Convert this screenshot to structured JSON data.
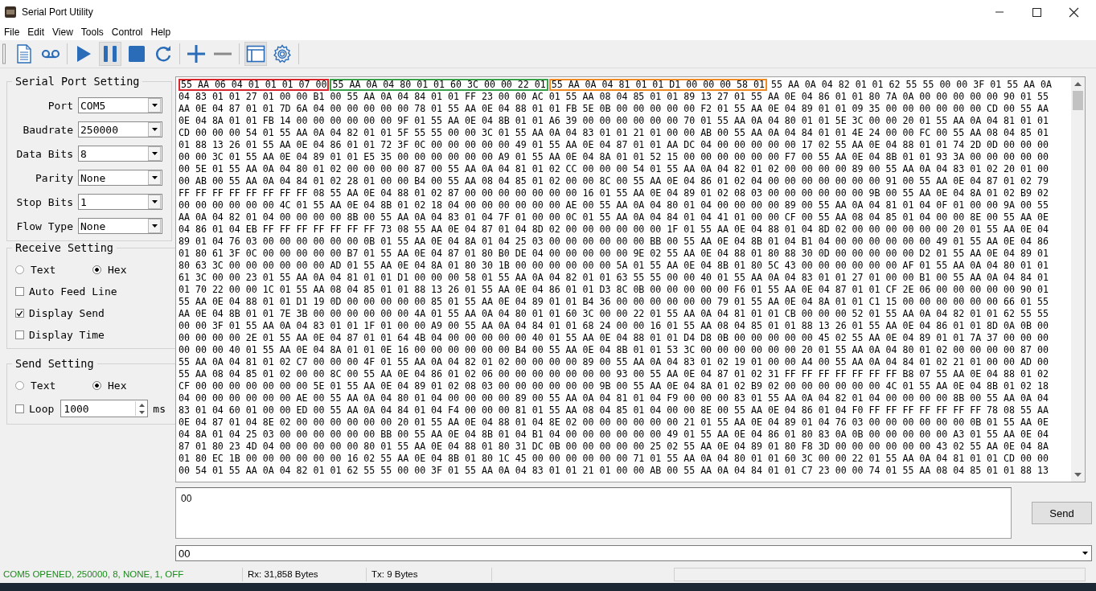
{
  "window": {
    "title": "Serial Port Utility"
  },
  "menu": [
    "File",
    "Edit",
    "View",
    "Tools",
    "Control",
    "Help"
  ],
  "toolbar": [
    {
      "kind": "document",
      "pressed": false
    },
    {
      "kind": "cassette",
      "pressed": false
    },
    {
      "kind": "separator"
    },
    {
      "kind": "play",
      "pressed": false
    },
    {
      "kind": "pause",
      "pressed": true
    },
    {
      "kind": "stop",
      "pressed": false
    },
    {
      "kind": "refresh",
      "pressed": false
    },
    {
      "kind": "separator"
    },
    {
      "kind": "plus",
      "pressed": false
    },
    {
      "kind": "minus",
      "pressed": false
    },
    {
      "kind": "separator"
    },
    {
      "kind": "window",
      "pressed": true
    },
    {
      "kind": "gear",
      "pressed": false
    },
    {
      "kind": "separator"
    }
  ],
  "serial_port_setting": {
    "title": "Serial Port Setting",
    "fields": [
      {
        "label": "Port",
        "value": "COM5"
      },
      {
        "label": "Baudrate",
        "value": "250000"
      },
      {
        "label": "Data Bits",
        "value": "8"
      },
      {
        "label": "Parity",
        "value": "None"
      },
      {
        "label": "Stop Bits",
        "value": "1"
      },
      {
        "label": "Flow Type",
        "value": "None"
      }
    ]
  },
  "receive_setting": {
    "title": "Receive Setting",
    "modes": [
      {
        "label": "Text",
        "selected": false
      },
      {
        "label": "Hex",
        "selected": true
      }
    ],
    "checkboxes": [
      {
        "label": "Auto Feed Line",
        "checked": false
      },
      {
        "label": "Display Send",
        "checked": true
      },
      {
        "label": "Display Time",
        "checked": false
      }
    ]
  },
  "send_setting": {
    "title": "Send Setting",
    "modes": [
      {
        "label": "Text",
        "selected": false
      },
      {
        "label": "Hex",
        "selected": true
      }
    ],
    "loop": {
      "label": "Loop",
      "checked": false,
      "value": "1000",
      "unit": "ms"
    }
  },
  "receive_view": {
    "first_row": [
      {
        "text": "55 AA 06 04 01 01 01 07 00",
        "color": "#d9262c"
      },
      {
        "text": "55 AA 0A 04 80 01 01 60 3C 00 00 22 01",
        "color": "#3aa04a"
      },
      {
        "text": "55 AA 0A 04 81 01 01 D1 00 00 00 58 01",
        "color": "#f08a24"
      },
      {
        "text": "55 AA 0A 04 82 01 01 62 55 55 00 00 3F 01 55 AA 0A"
      }
    ],
    "rows": [
      "04 83 01 01 27 01 00 00 B1 00 55 AA 0A 04 84 01 01 FF 23 00 00 AC 01 55 AA 08 04 85 01 01 89 13 27 01 55 AA 0E 04 86 01 01 80 7A 0A 00 00 00 00 00 90 01 55",
      "AA 0E 04 87 01 01 7D 6A 04 00 00 00 00 00 78 01 55 AA 0E 04 88 01 01 FB 5E 0B 00 00 00 00 00 F2 01 55 AA 0E 04 89 01 01 09 35 00 00 00 00 00 00 CD 00 55 AA",
      "0E 04 8A 01 01 FB 14 00 00 00 00 00 00 9F 01 55 AA 0E 04 8B 01 01 A6 39 00 00 00 00 00 00 70 01 55 AA 0A 04 80 01 01 5E 3C 00 00 20 01 55 AA 0A 04 81 01 01",
      "CD 00 00 00 54 01 55 AA 0A 04 82 01 01 5F 55 55 00 00 3C 01 55 AA 0A 04 83 01 01 21 01 00 00 AB 00 55 AA 0A 04 84 01 01 4E 24 00 00 FC 00 55 AA 08 04 85 01",
      "01 88 13 26 01 55 AA 0E 04 86 01 01 72 3F 0C 00 00 00 00 00 49 01 55 AA 0E 04 87 01 01 AA DC 04 00 00 00 00 00 17 02 55 AA 0E 04 88 01 01 74 2D 0D 00 00 00",
      "00 00 3C 01 55 AA 0E 04 89 01 01 E5 35 00 00 00 00 00 00 A9 01 55 AA 0E 04 8A 01 01 52 15 00 00 00 00 00 00 F7 00 55 AA 0E 04 8B 01 01 93 3A 00 00 00 00 00",
      "00 5E 01 55 AA 0A 04 80 01 02 00 00 00 00 87 00 55 AA 0A 04 81 01 02 CC 00 00 00 54 01 55 AA 0A 04 82 01 02 00 00 00 00 89 00 55 AA 0A 04 83 01 02 20 01 00",
      "00 AB 00 55 AA 0A 04 84 01 02 28 01 00 00 B4 00 55 AA 08 04 85 01 02 00 00 8C 00 55 AA 0E 04 86 01 02 04 00 00 00 00 00 00 00 91 00 55 AA 0E 04 87 01 02 79",
      "FF FF FF FF FF FF FF FF 08 55 AA 0E 04 88 01 02 87 00 00 00 00 00 00 00 16 01 55 AA 0E 04 89 01 02 08 03 00 00 00 00 00 00 9B 00 55 AA 0E 04 8A 01 02 B9 02",
      "00 00 00 00 00 00 4C 01 55 AA 0E 04 8B 01 02 18 04 00 00 00 00 00 00 AE 00 55 AA 0A 04 80 01 04 00 00 00 00 89 00 55 AA 0A 04 81 01 04 0F 01 00 00 9A 00 55",
      "AA 0A 04 82 01 04 00 00 00 00 8B 00 55 AA 0A 04 83 01 04 7F 01 00 00 0C 01 55 AA 0A 04 84 01 04 41 01 00 00 CF 00 55 AA 08 04 85 01 04 00 00 8E 00 55 AA 0E",
      "04 86 01 04 EB FF FF FF FF FF FF FF 73 08 55 AA 0E 04 87 01 04 8D 02 00 00 00 00 00 00 1F 01 55 AA 0E 04 88 01 04 8D 02 00 00 00 00 00 00 20 01 55 AA 0E 04",
      "89 01 04 76 03 00 00 00 00 00 00 0B 01 55 AA 0E 04 8A 01 04 25 03 00 00 00 00 00 00 BB 00 55 AA 0E 04 8B 01 04 B1 04 00 00 00 00 00 00 49 01 55 AA 0E 04 86",
      "01 80 61 3F 0C 00 00 00 00 00 B7 01 55 AA 0E 04 87 01 80 B0 DE 04 00 00 00 00 00 9E 02 55 AA 0E 04 88 01 80 88 30 0D 00 00 00 00 00 D2 01 55 AA 0E 04 89 01",
      "80 63 3C 00 00 00 00 00 00 AD 01 55 AA 0E 04 8A 01 80 30 1B 00 00 00 00 00 00 5A 01 55 AA 0E 04 8B 01 80 5C 43 00 00 00 00 00 00 AF 01 55 AA 0A 04 80 01 01",
      "61 3C 00 00 23 01 55 AA 0A 04 81 01 01 D1 00 00 00 58 01 55 AA 0A 04 82 01 01 63 55 55 00 00 40 01 55 AA 0A 04 83 01 01 27 01 00 00 B1 00 55 AA 0A 04 84 01",
      "01 70 22 00 00 1C 01 55 AA 08 04 85 01 01 88 13 26 01 55 AA 0E 04 86 01 01 D3 8C 0B 00 00 00 00 00 F6 01 55 AA 0E 04 87 01 01 CF 2E 06 00 00 00 00 00 90 01",
      "55 AA 0E 04 88 01 01 D1 19 0D 00 00 00 00 00 85 01 55 AA 0E 04 89 01 01 B4 36 00 00 00 00 00 00 79 01 55 AA 0E 04 8A 01 01 C1 15 00 00 00 00 00 00 66 01 55",
      "AA 0E 04 8B 01 01 7E 3B 00 00 00 00 00 00 4A 01 55 AA 0A 04 80 01 01 60 3C 00 00 22 01 55 AA 0A 04 81 01 01 CB 00 00 00 52 01 55 AA 0A 04 82 01 01 62 55 55",
      "00 00 3F 01 55 AA 0A 04 83 01 01 1F 01 00 00 A9 00 55 AA 0A 04 84 01 01 68 24 00 00 16 01 55 AA 08 04 85 01 01 88 13 26 01 55 AA 0E 04 86 01 01 8D 0A 0B 00",
      "00 00 00 00 2E 01 55 AA 0E 04 87 01 01 64 4B 04 00 00 00 00 00 40 01 55 AA 0E 04 88 01 01 D4 D8 0B 00 00 00 00 00 45 02 55 AA 0E 04 89 01 01 7A 37 00 00 00",
      "00 00 00 40 01 55 AA 0E 04 8A 01 01 0E 16 00 00 00 00 00 00 B4 00 55 AA 0E 04 8B 01 01 53 3C 00 00 00 00 00 00 20 01 55 AA 0A 04 80 01 02 00 00 00 00 87 00",
      "55 AA 0A 04 81 01 02 C7 00 00 00 4F 01 55 AA 0A 04 82 01 02 00 00 00 00 89 00 55 AA 0A 04 83 01 02 19 01 00 00 A4 00 55 AA 0A 04 84 01 02 21 01 00 00 AD 00",
      "55 AA 08 04 85 01 02 00 00 8C 00 55 AA 0E 04 86 01 02 06 00 00 00 00 00 00 00 93 00 55 AA 0E 04 87 01 02 31 FF FF FF FF FF FF FF B8 07 55 AA 0E 04 88 01 02",
      "CF 00 00 00 00 00 00 00 5E 01 55 AA 0E 04 89 01 02 08 03 00 00 00 00 00 00 9B 00 55 AA 0E 04 8A 01 02 B9 02 00 00 00 00 00 00 4C 01 55 AA 0E 04 8B 01 02 18",
      "04 00 00 00 00 00 00 AE 00 55 AA 0A 04 80 01 04 00 00 00 00 89 00 55 AA 0A 04 81 01 04 F9 00 00 00 83 01 55 AA 0A 04 82 01 04 00 00 00 00 8B 00 55 AA 0A 04",
      "83 01 04 60 01 00 00 ED 00 55 AA 0A 04 84 01 04 F4 00 00 00 81 01 55 AA 08 04 85 01 04 00 00 8E 00 55 AA 0E 04 86 01 04 F0 FF FF FF FF FF FF FF 78 08 55 AA",
      "0E 04 87 01 04 8E 02 00 00 00 00 00 00 20 01 55 AA 0E 04 88 01 04 8E 02 00 00 00 00 00 00 21 01 55 AA 0E 04 89 01 04 76 03 00 00 00 00 00 00 0B 01 55 AA 0E",
      "04 8A 01 04 25 03 00 00 00 00 00 00 BB 00 55 AA 0E 04 8B 01 04 B1 04 00 00 00 00 00 00 49 01 55 AA 0E 04 86 01 80 83 0A 0B 00 00 00 00 00 A3 01 55 AA 0E 04",
      "87 01 80 23 4D 04 00 00 00 00 00 80 01 55 AA 0E 04 88 01 80 31 DC 0B 00 00 00 00 00 25 02 55 AA 0E 04 89 01 80 F8 3D 00 00 00 00 00 00 43 02 55 AA 0E 04 8A",
      "01 80 EC 1B 00 00 00 00 00 00 16 02 55 AA 0E 04 8B 01 80 1C 45 00 00 00 00 00 00 71 01 55 AA 0A 04 80 01 01 60 3C 00 00 22 01 55 AA 0A 04 81 01 01 CD 00 00",
      "00 54 01 55 AA 0A 04 82 01 01 62 55 55 00 00 3F 01 55 AA 0A 04 83 01 01 21 01 00 00 AB 00 55 AA 0A 04 84 01 01 C7 23 00 00 74 01 55 AA 08 04 85 01 01 88 13"
    ]
  },
  "send_box": {
    "value": "00"
  },
  "send_button": "Send",
  "history": {
    "value": "00"
  },
  "status_bar": {
    "connection": "COM5 OPENED, 250000, 8, NONE, 1, OFF",
    "rx": "Rx: 31,858 Bytes",
    "tx": "Tx: 9 Bytes"
  }
}
